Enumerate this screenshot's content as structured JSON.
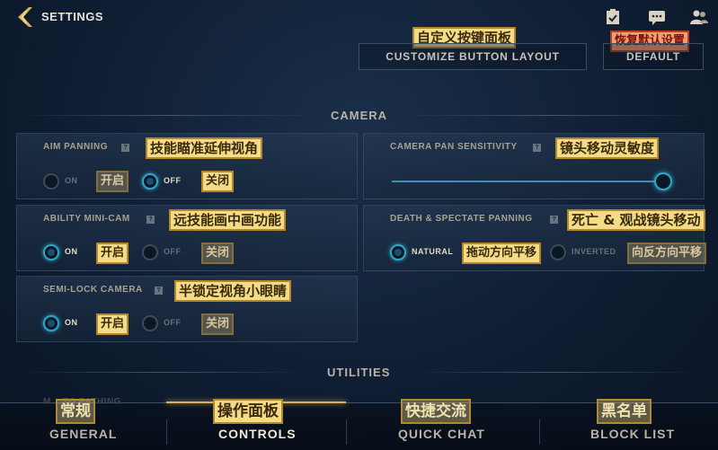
{
  "header": {
    "title": "SETTINGS",
    "icons": [
      "back-chevron-icon",
      "clipboard-check-icon",
      "chat-icon",
      "friends-icon"
    ]
  },
  "top_actions": {
    "customize_label": "CUSTOMIZE BUTTON LAYOUT",
    "customize_note": "自定义按键面板",
    "default_label": "DEFAULT",
    "default_note": "恢复默认设置"
  },
  "camera": {
    "section_title": "CAMERA",
    "aim_panning": {
      "label": "AIM PANNING",
      "note": "技能瞄准延伸视角",
      "on_label": "ON",
      "on_note": "开启",
      "off_label": "OFF",
      "off_note": "关闭",
      "selected": "off"
    },
    "camera_pan_sensitivity": {
      "label": "CAMERA PAN SENSITIVITY",
      "note": "镜头移动灵敏度",
      "value_fraction": 1.0
    },
    "ability_mini_cam": {
      "label": "ABILITY MINI-CAM",
      "note": "远技能画中画功能",
      "on_label": "ON",
      "on_note": "开启",
      "off_label": "OFF",
      "off_note": "关闭",
      "selected": "on"
    },
    "death_spectate_panning": {
      "label": "DEATH & SPECTATE PANNING",
      "note": "死亡 & 观战镜头移动",
      "natural_label": "NATURAL",
      "natural_note": "拖动方向平移",
      "inverted_label": "INVERTED",
      "inverted_note": "向反方向平移",
      "selected": "natural"
    },
    "semi_lock_camera": {
      "label": "SEMI-LOCK CAMERA",
      "note": "半锁定视角小眼睛",
      "on_label": "ON",
      "on_note": "开启",
      "off_label": "OFF",
      "off_note": "关闭",
      "selected": "on"
    }
  },
  "utilities": {
    "section_title": "UTILITIES",
    "partial_label": "M... TO PATHING"
  },
  "bottom_nav": [
    {
      "label": "GENERAL",
      "note": "常规",
      "active": false
    },
    {
      "label": "CONTROLS",
      "note": "操作面板",
      "active": true
    },
    {
      "label": "QUICK CHAT",
      "note": "快捷交流",
      "active": false
    },
    {
      "label": "BLOCK LIST",
      "note": "黑名单",
      "active": false
    }
  ],
  "colors": {
    "accent": "#2ea6c8",
    "gold": "#d8b15a",
    "annotation": "#f4dc86"
  }
}
